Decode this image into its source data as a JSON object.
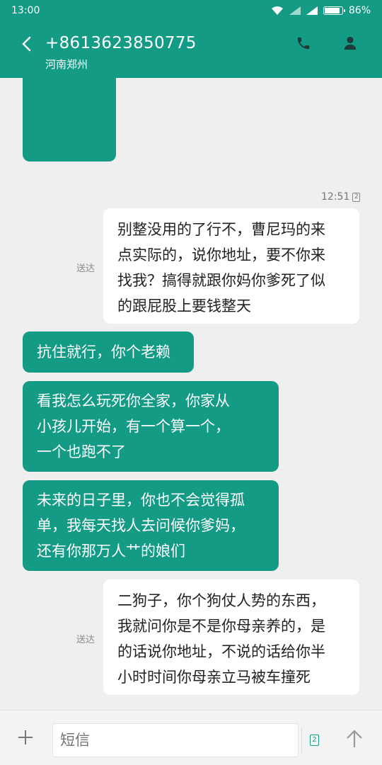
{
  "status_bar": {
    "time": "13:00",
    "battery_text": "86%",
    "battery_level": 0.86
  },
  "header": {
    "phone_number": "+8613623850775",
    "location": "河南郑州"
  },
  "colors": {
    "brand": "#139b86",
    "background": "#efefef"
  },
  "messages": [
    {
      "direction": "out",
      "time": "12:51",
      "sim": "2",
      "status": "送达",
      "lines": [
        "别整没用的了行不，曹尼玛的来",
        "点实际的，说你地址，要不你来",
        "找我？搞得就跟你妈你爹死了似",
        "的跟屁股上要钱整天"
      ]
    },
    {
      "direction": "in",
      "lines": [
        "抗住就行，你个老赖"
      ]
    },
    {
      "direction": "in",
      "lines": [
        "看我怎么玩死你全家，你家从",
        "小孩儿开始，有一个算一个，",
        "一个也跑不了"
      ]
    },
    {
      "direction": "in",
      "lines": [
        "未来的日子里，你也不会觉得孤",
        "单，我每天找人去问候你爹妈，",
        "还有你那万人艹的娘们"
      ]
    },
    {
      "direction": "out",
      "status": "送达",
      "lines": [
        "二狗子，你个狗仗人势的东西，",
        "我就问你是不是你母亲养的，是",
        "的话说你地址，不说的话给你半",
        "小时时间你母亲立马被车撞死"
      ]
    }
  ],
  "composer": {
    "placeholder": "短信",
    "sim": "2"
  },
  "icons": {
    "back": "back-icon",
    "call": "phone-icon",
    "contact": "person-icon",
    "add": "plus-icon",
    "send": "send-icon"
  }
}
